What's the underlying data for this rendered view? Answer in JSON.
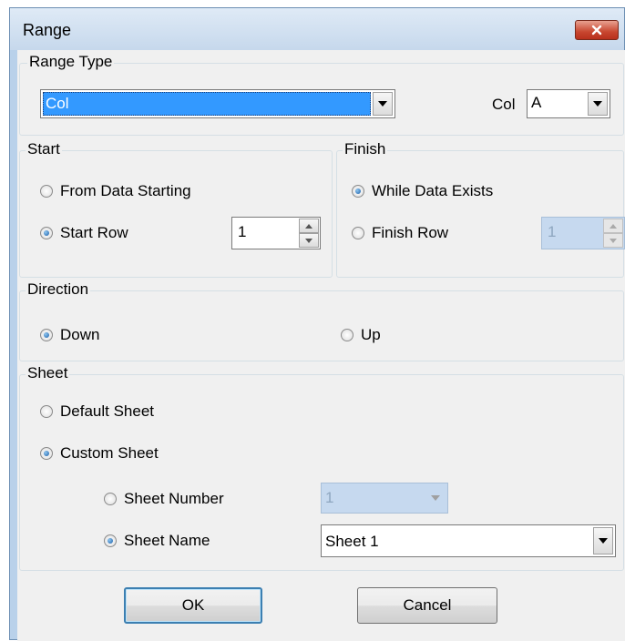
{
  "window": {
    "title": "Range"
  },
  "range_type": {
    "legend": "Range Type",
    "type_value": "Col",
    "col_label": "Col",
    "col_value": "A"
  },
  "start": {
    "legend": "Start",
    "from_data_starting": "From Data Starting",
    "start_row": "Start Row",
    "start_row_value": "1",
    "selected": "Start Row"
  },
  "finish": {
    "legend": "Finish",
    "while_data_exists": "While Data Exists",
    "finish_row": "Finish Row",
    "finish_row_value": "1",
    "selected": "While Data Exists"
  },
  "direction": {
    "legend": "Direction",
    "down": "Down",
    "up": "Up",
    "selected": "Down"
  },
  "sheet": {
    "legend": "Sheet",
    "default_sheet": "Default Sheet",
    "custom_sheet": "Custom Sheet",
    "sheet_number": "Sheet Number",
    "sheet_number_value": "1",
    "sheet_name": "Sheet Name",
    "sheet_name_value": "Sheet 1",
    "selected": "Custom Sheet",
    "custom_selected": "Sheet Name"
  },
  "buttons": {
    "ok": "OK",
    "cancel": "Cancel"
  },
  "colors": {
    "selection": "#3399ff",
    "disabled_field": "#c6d9ef",
    "close_button": "#c8462f"
  }
}
